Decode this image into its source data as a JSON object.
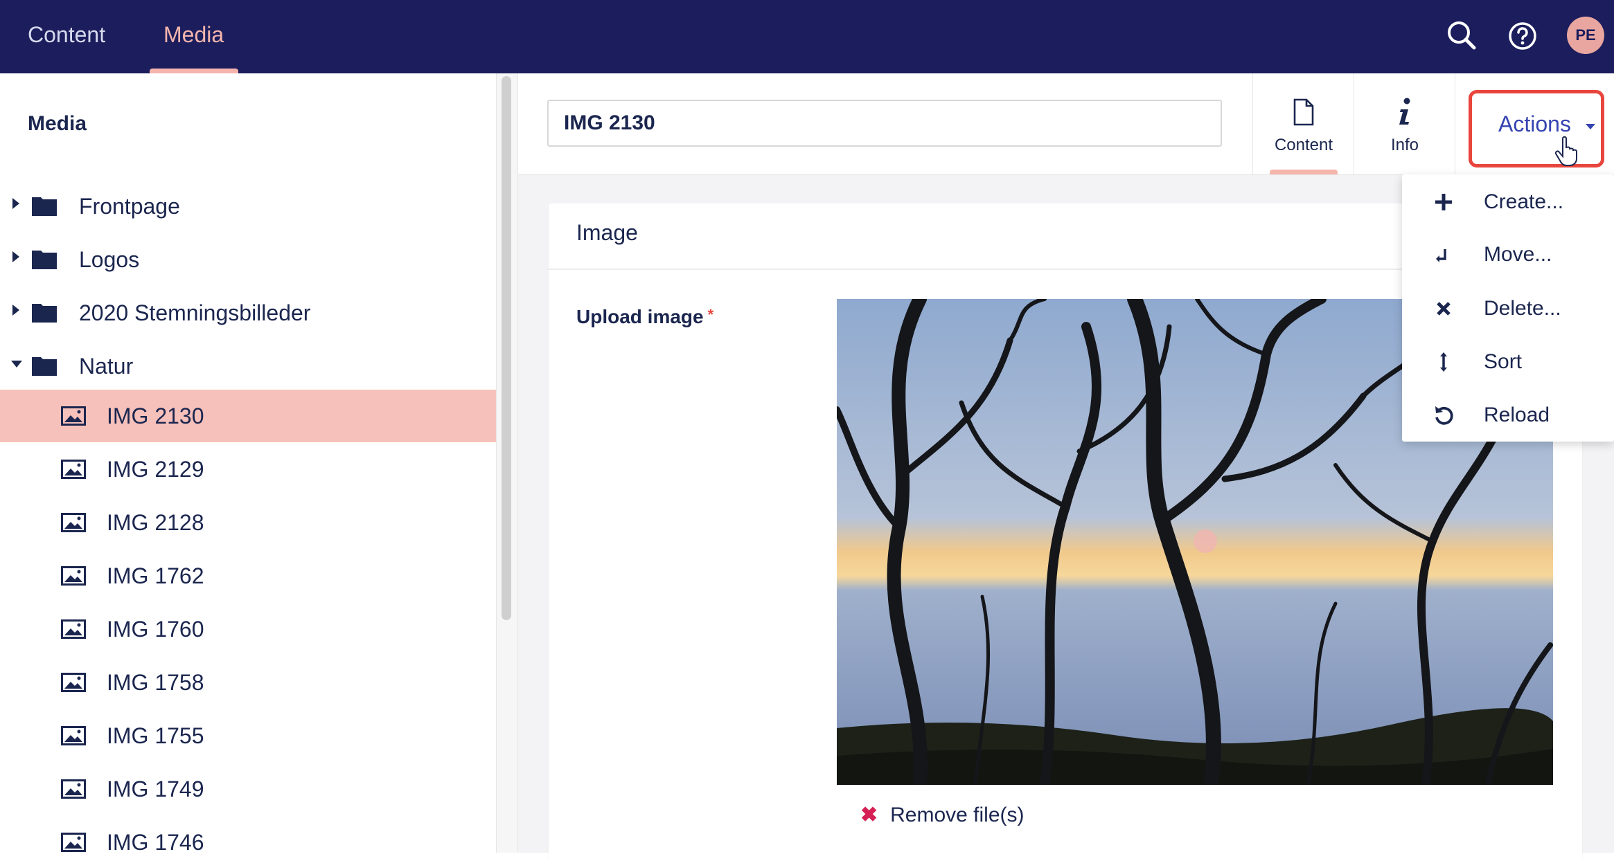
{
  "topnav": {
    "items": [
      {
        "label": "Content",
        "active": false
      },
      {
        "label": "Media",
        "active": true
      }
    ],
    "search_icon": "search-icon",
    "help_icon": "help-icon",
    "avatar_initials": "PE"
  },
  "sidebar": {
    "title": "Media",
    "folders": [
      {
        "label": "Frontpage",
        "expanded": false
      },
      {
        "label": "Logos",
        "expanded": false
      },
      {
        "label": "2020 Stemningsbilleder",
        "expanded": false
      },
      {
        "label": "Natur",
        "expanded": true
      }
    ],
    "items": [
      {
        "label": "IMG 2130",
        "active": true
      },
      {
        "label": "IMG 2129",
        "active": false
      },
      {
        "label": "IMG 2128",
        "active": false
      },
      {
        "label": "IMG 1762",
        "active": false
      },
      {
        "label": "IMG 1760",
        "active": false
      },
      {
        "label": "IMG 1758",
        "active": false
      },
      {
        "label": "IMG 1755",
        "active": false
      },
      {
        "label": "IMG 1749",
        "active": false
      },
      {
        "label": "IMG 1746",
        "active": false
      }
    ]
  },
  "editor": {
    "name_value": "IMG 2130",
    "tabs": [
      {
        "label": "Content",
        "icon": "document-icon",
        "active": true
      },
      {
        "label": "Info",
        "icon": "info-icon",
        "active": false
      }
    ],
    "actions_label": "Actions"
  },
  "panel": {
    "title": "Image",
    "field_label": "Upload image",
    "required_mark": "*",
    "remove_label": "Remove file(s)"
  },
  "actions_menu": {
    "items": [
      {
        "label": "Create...",
        "icon": "plus-icon"
      },
      {
        "label": "Move...",
        "icon": "move-icon"
      },
      {
        "label": "Delete...",
        "icon": "delete-icon"
      },
      {
        "label": "Sort",
        "icon": "sort-icon"
      },
      {
        "label": "Reload",
        "icon": "reload-icon"
      }
    ]
  },
  "colors": {
    "topbar": "#1b1d5c",
    "accent": "#f5b5ad",
    "active_row": "#f7c1bb",
    "actions_text": "#3544b1",
    "highlight_border": "#e8453c"
  }
}
